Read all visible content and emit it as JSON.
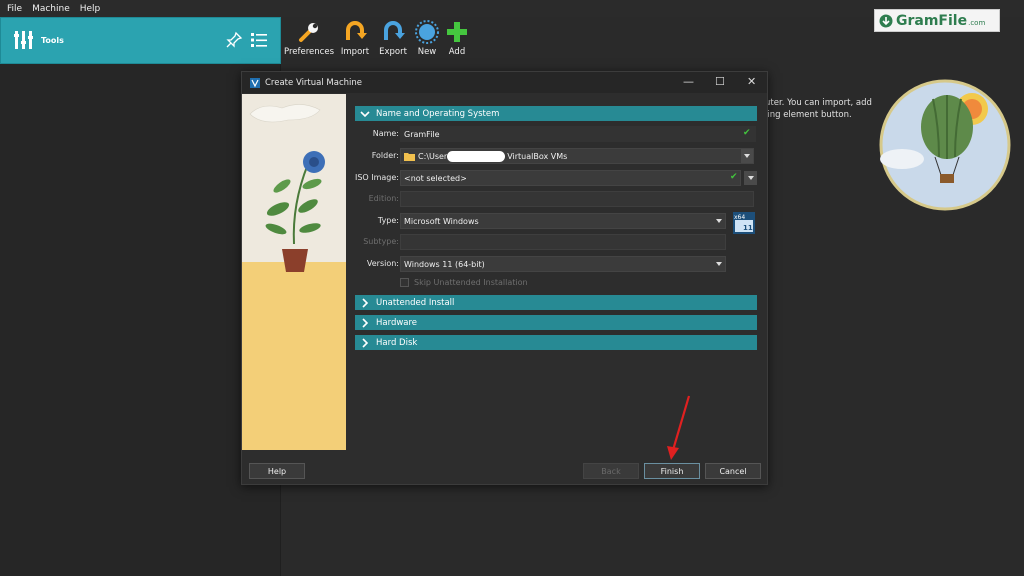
{
  "menubar": {
    "file": "File",
    "machine": "Machine",
    "help": "Help"
  },
  "tools": {
    "label": "Tools"
  },
  "toolbar": [
    {
      "label": "Preferences",
      "icon": "wrench-icon"
    },
    {
      "label": "Import",
      "icon": "import-icon"
    },
    {
      "label": "Export",
      "icon": "export-icon"
    },
    {
      "label": "New",
      "icon": "new-icon"
    },
    {
      "label": "Add",
      "icon": "add-icon"
    }
  ],
  "welcome": {
    "line1": "uter. You can import, add",
    "line2": "ling element button."
  },
  "watermark": {
    "brand": "GramFile",
    "suffix": ".com"
  },
  "dialog": {
    "title": "Create Virtual Machine",
    "section_name_os": "Name and Operating System",
    "name_label": "Name:",
    "name_value": "GramFile",
    "folder_label": "Folder:",
    "folder_prefix": "C:\\User",
    "folder_suffix": "VirtualBox VMs",
    "iso_label": "ISO Image:",
    "iso_value": "<not selected>",
    "edition_label": "Edition:",
    "type_label": "Type:",
    "type_value": "Microsoft Windows",
    "subtype_label": "Subtype:",
    "version_label": "Version:",
    "version_value": "Windows 11 (64-bit)",
    "skip_label": "Skip Unattended Installation",
    "section_unattended": "Unattended Install",
    "section_hardware": "Hardware",
    "section_harddisk": "Hard Disk",
    "os_badge_text": "x64",
    "os_badge_num": "11",
    "help_button": "Help",
    "back_button": "Back",
    "finish_button": "Finish",
    "cancel_button": "Cancel"
  },
  "colors": {
    "accent": "#2ba3b0",
    "section": "#278a94",
    "check": "#43c43e",
    "arrow": "#e02020"
  }
}
